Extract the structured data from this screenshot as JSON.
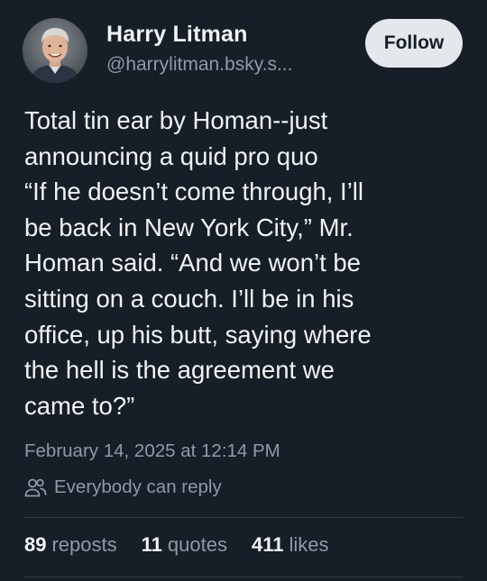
{
  "author": {
    "display_name": "Harry Litman",
    "handle": "@harrylitman.bsky.s..."
  },
  "actions": {
    "follow_label": "Follow"
  },
  "post": {
    "lines": [
      "Total tin ear by Homan--just",
      "announcing a quid pro quo",
      "“If he doesn’t come through, I’ll",
      "be back in New York City,” Mr.",
      "Homan said. “And we won’t be",
      "sitting on a couch. I’ll be in his",
      "office, up his butt, saying where",
      "the hell is the agreement we",
      "came to?”"
    ],
    "timestamp": "February 14, 2025 at 12:14 PM",
    "reply_setting": "Everybody can reply"
  },
  "stats": {
    "reposts_count": "89",
    "reposts_label": "reposts",
    "quotes_count": "11",
    "quotes_label": "quotes",
    "likes_count": "411",
    "likes_label": "likes"
  },
  "colors": {
    "background": "#161e27",
    "text": "#f1f3f5",
    "muted": "#8d9aa8",
    "follow_button_bg": "#e4e8ec",
    "divider": "#2e3947"
  },
  "icons": {
    "reply_setting": "people-icon"
  }
}
